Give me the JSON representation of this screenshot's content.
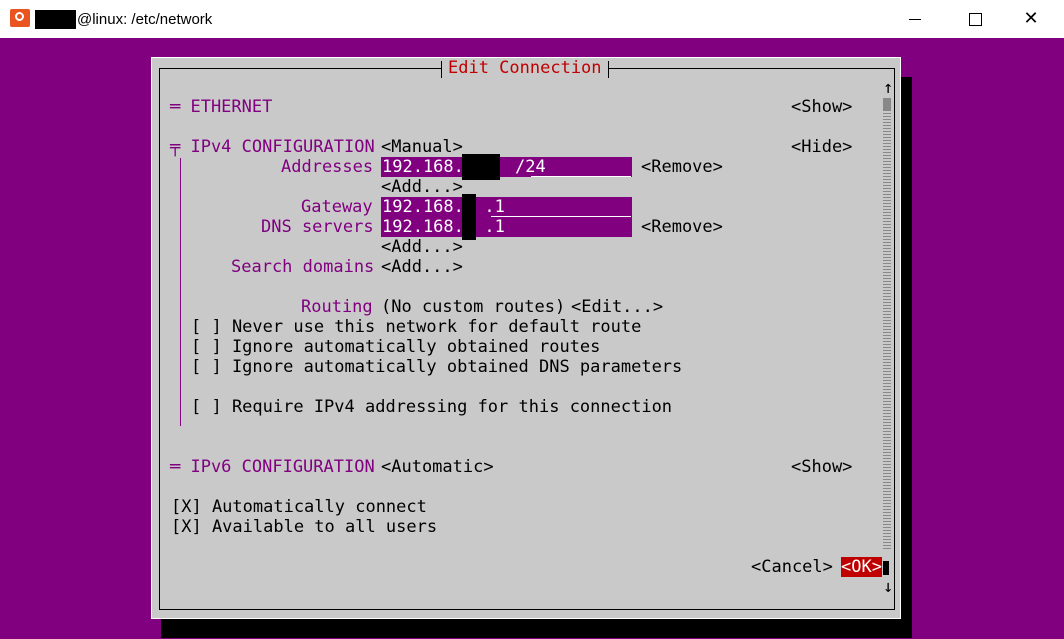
{
  "window": {
    "title": "@linux: /etc/network",
    "minimize_glyph": "",
    "close_glyph": "✕"
  },
  "dialog": {
    "title": "Edit Connection",
    "ethernet": {
      "label": "═ ETHERNET",
      "show": "<Show>"
    },
    "ipv4": {
      "label": "╤ IPv4 CONFIGURATION",
      "method": "<Manual>",
      "hide": "<Hide>",
      "addresses_label": "Addresses",
      "address_value": "192.168.     /24",
      "remove_address": "<Remove>",
      "add_address": "<Add...>",
      "gateway_label": "Gateway",
      "gateway_value": "192.168.  .1",
      "dns_label": "DNS servers",
      "dns_value": "192.168.  .1",
      "remove_dns": "<Remove>",
      "add_dns": "<Add...>",
      "search_label": "Search domains",
      "add_search": "<Add...>",
      "routing_label": "Routing",
      "routing_value": "(No custom routes)",
      "routing_edit": "<Edit...>",
      "opt_never_default": "[ ] Never use this network for default route",
      "opt_ignore_routes": "[ ] Ignore automatically obtained routes",
      "opt_ignore_dns": "[ ] Ignore automatically obtained DNS parameters",
      "opt_require_ipv4": "[ ] Require IPv4 addressing for this connection"
    },
    "ipv6": {
      "label": "═ IPv6 CONFIGURATION",
      "method": "<Automatic>",
      "show": "<Show>"
    },
    "auto_connect": "[X] Automatically connect",
    "all_users": "[X] Available to all users",
    "cancel": "<Cancel>",
    "ok": "<OK>",
    "scroll_up": "↑",
    "scroll_down": "↓"
  },
  "colors": {
    "terminal_bg": "#800080",
    "dialog_bg": "#c9c9c9",
    "accent_red": "#c00000",
    "label_purple": "#800080"
  }
}
